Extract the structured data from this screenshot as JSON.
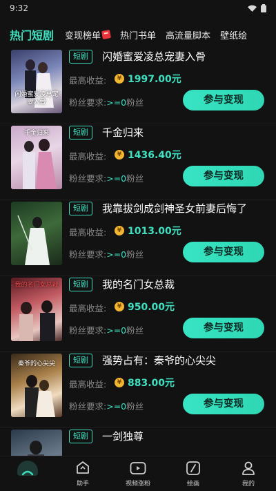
{
  "status_bar": {
    "time": "9:32"
  },
  "tabs": [
    {
      "label": "热门短剧",
      "active": true
    },
    {
      "label": "变现榜单"
    },
    {
      "label": "热门书单"
    },
    {
      "label": "高流量脚本"
    },
    {
      "label": "壁纸绘"
    }
  ],
  "colors": {
    "accent": "#3fe0c0",
    "coin": "#f2b632",
    "background": "#121212"
  },
  "list": {
    "items": [
      {
        "tag": "短剧",
        "title": "闪婚蜜爱凌总宠妻入骨",
        "earn_label": "最高收益:",
        "amount": "1997.00元",
        "fans_label": "粉丝要求:",
        "fans_value": ">=0",
        "fans_unit": "粉丝",
        "button": "参与变现",
        "poster_text": "闪婚蜜爱凌总宠妻入骨"
      },
      {
        "tag": "短剧",
        "title": "千金归来",
        "earn_label": "最高收益:",
        "amount": "1436.40元",
        "fans_label": "粉丝要求:",
        "fans_value": ">=0",
        "fans_unit": "粉丝",
        "button": "参与变现",
        "poster_text": "千金归来"
      },
      {
        "tag": "短剧",
        "title": "我靠拔剑成剑神圣女前妻后悔了",
        "earn_label": "最高收益:",
        "amount": "1013.00元",
        "fans_label": "粉丝要求:",
        "fans_value": ">=0",
        "fans_unit": "粉丝",
        "button": "参与变现",
        "poster_text": ""
      },
      {
        "tag": "短剧",
        "title": "我的名门女总裁",
        "earn_label": "最高收益:",
        "amount": "950.00元",
        "fans_label": "粉丝要求:",
        "fans_value": ">=0",
        "fans_unit": "粉丝",
        "button": "参与变现",
        "poster_text": "我的名门女总裁"
      },
      {
        "tag": "短剧",
        "title": "强势占有：秦爷的心尖尖",
        "earn_label": "最高收益:",
        "amount": "883.00元",
        "fans_label": "粉丝要求:",
        "fans_value": ">=0",
        "fans_unit": "粉丝",
        "button": "参与变现",
        "poster_text": "秦爷的心尖尖"
      },
      {
        "tag": "短剧",
        "title": "一剑独尊",
        "earn_label": "",
        "amount": "",
        "fans_label": "",
        "fans_value": "",
        "fans_unit": "",
        "button": "",
        "poster_text": ""
      }
    ]
  },
  "bottom_nav": [
    {
      "label": "",
      "icon": "home-icon",
      "active": true
    },
    {
      "label": "助手",
      "icon": "assistant-icon"
    },
    {
      "label": "视频涨粉",
      "icon": "video-icon"
    },
    {
      "label": "绘画",
      "icon": "paint-icon"
    },
    {
      "label": "我的",
      "icon": "profile-icon"
    }
  ]
}
